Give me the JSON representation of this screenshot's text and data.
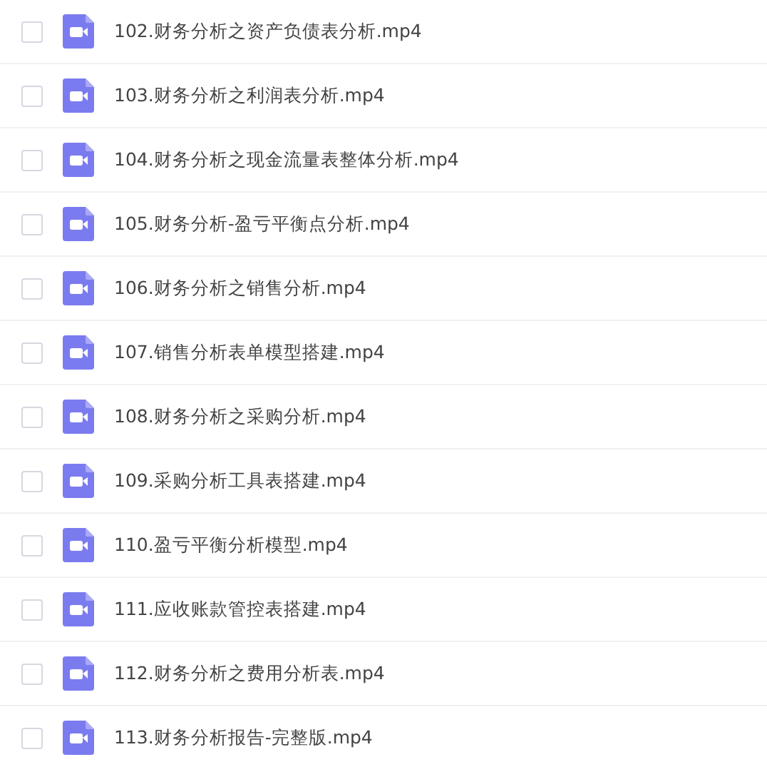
{
  "files": [
    {
      "name": "102.财务分析之资产负债表分析.mp4",
      "checked": false
    },
    {
      "name": "103.财务分析之利润表分析.mp4",
      "checked": false
    },
    {
      "name": "104.财务分析之现金流量表整体分析.mp4",
      "checked": false
    },
    {
      "name": "105.财务分析-盈亏平衡点分析.mp4",
      "checked": false
    },
    {
      "name": "106.财务分析之销售分析.mp4",
      "checked": false
    },
    {
      "name": "107.销售分析表单模型搭建.mp4",
      "checked": false
    },
    {
      "name": "108.财务分析之采购分析.mp4",
      "checked": false
    },
    {
      "name": "109.采购分析工具表搭建.mp4",
      "checked": false
    },
    {
      "name": "110.盈亏平衡分析模型.mp4",
      "checked": false
    },
    {
      "name": "111.应收账款管控表搭建.mp4",
      "checked": false
    },
    {
      "name": "112.财务分析之费用分析表.mp4",
      "checked": false
    },
    {
      "name": "113.财务分析报告-完整版.mp4",
      "checked": false
    }
  ]
}
